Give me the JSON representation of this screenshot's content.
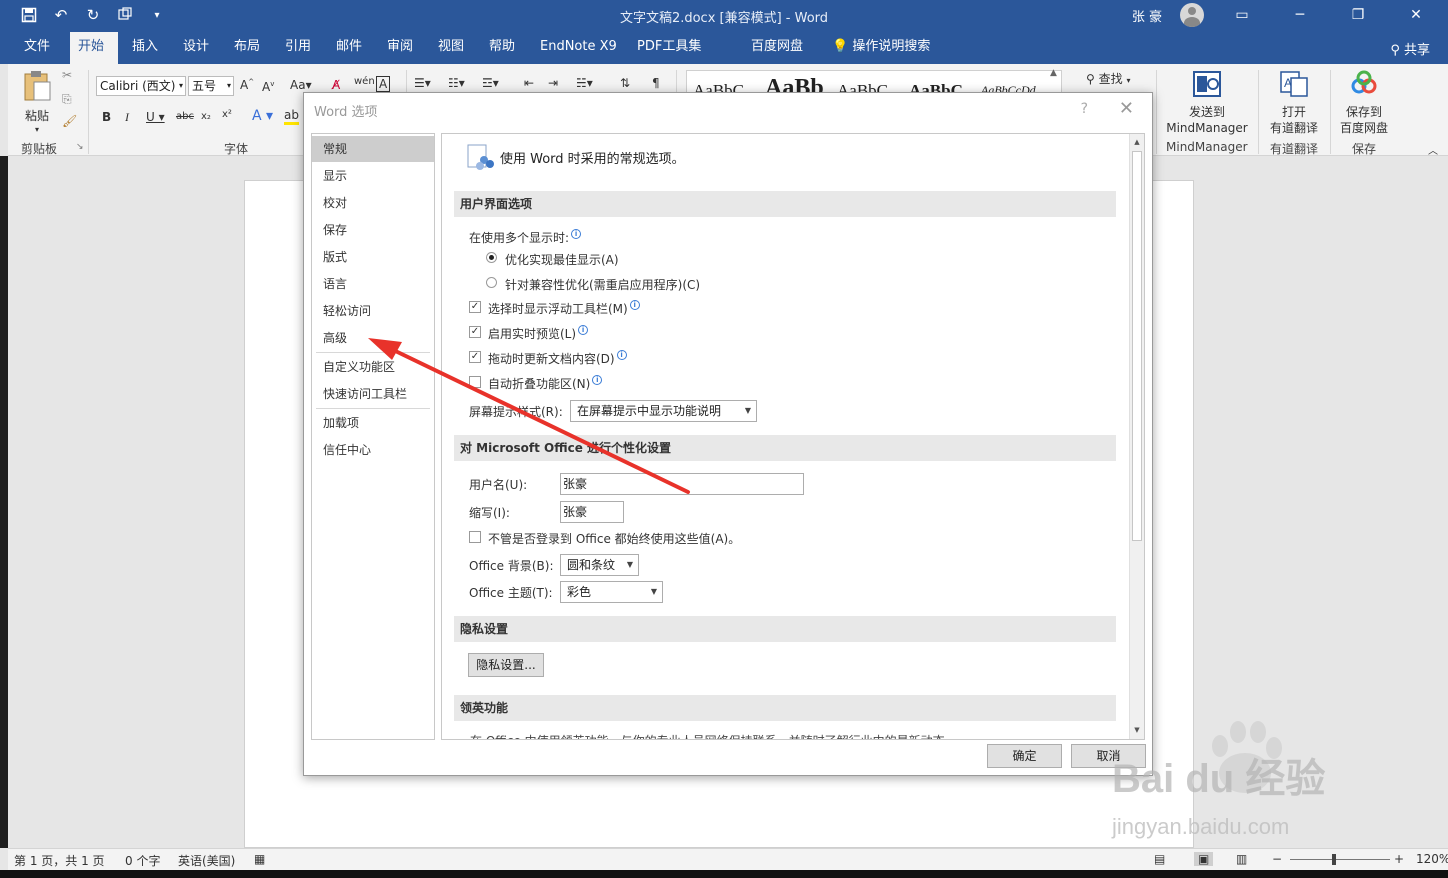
{
  "titlebar": {
    "doc_title": "文字文稿2.docx [兼容模式] - Word",
    "user_name": "张 豪",
    "qat_icons": [
      "save-icon",
      "undo-icon",
      "redo-icon",
      "touch-mode-icon",
      "customize-qat-icon"
    ]
  },
  "tabs": [
    {
      "label": "文件"
    },
    {
      "label": "开始"
    },
    {
      "label": "插入"
    },
    {
      "label": "设计"
    },
    {
      "label": "布局"
    },
    {
      "label": "引用"
    },
    {
      "label": "邮件"
    },
    {
      "label": "审阅"
    },
    {
      "label": "视图"
    },
    {
      "label": "帮助"
    },
    {
      "label": "EndNote X9"
    },
    {
      "label": "PDF工具集"
    },
    {
      "label": "百度网盘"
    },
    {
      "label": "操作说明搜索"
    }
  ],
  "share_label": "共享",
  "ribbon": {
    "paste_label": "粘贴",
    "clipboard_label": "剪贴板",
    "font_name": "Calibri (西文)",
    "font_size": "五号",
    "font_group_label": "字体",
    "styles_preview": [
      "AaBbC",
      "AaBb",
      "AaBbC",
      "AaBbC",
      "AaBbCcDd"
    ],
    "find_label": "查找",
    "mindmanager_send": "发送到",
    "mindmanager_name": "MindManager",
    "mindmanager_group": "MindManager",
    "youdao_open": "打开",
    "youdao_translate": "有道翻译",
    "youdao_group": "有道翻译",
    "baidu_save": "保存到",
    "baidu_disk": "百度网盘",
    "baidu_group": "保存"
  },
  "dialog": {
    "title": "Word 选项",
    "help": "?",
    "close": "✕",
    "nav_items": [
      {
        "label": "常规",
        "selected": true
      },
      {
        "label": "显示"
      },
      {
        "label": "校对"
      },
      {
        "label": "保存"
      },
      {
        "label": "版式"
      },
      {
        "label": "语言"
      },
      {
        "label": "轻松访问"
      },
      {
        "label": "高级"
      },
      {
        "label": "自定义功能区"
      },
      {
        "label": "快速访问工具栏"
      },
      {
        "label": "加载项"
      },
      {
        "label": "信任中心"
      }
    ],
    "intro": "使用 Word 时采用的常规选项。",
    "ui_section": "用户界面选项",
    "multi_display_label": "在使用多个显示时:",
    "radio_best": "优化实现最佳显示(A)",
    "radio_compat": "针对兼容性优化(需重启应用程序)(C)",
    "chk_minitoolbar": "选择时显示浮动工具栏(M)",
    "chk_livepreview": "启用实时预览(L)",
    "chk_dragupdate": "拖动时更新文档内容(D)",
    "chk_collapse": "自动折叠功能区(N)",
    "screentip_label": "屏幕提示样式(R):",
    "screentip_value": "在屏幕提示中显示功能说明",
    "personalize_section": "对 Microsoft Office 进行个性化设置",
    "username_label": "用户名(U):",
    "username_value": "张豪",
    "initials_label": "缩写(I):",
    "initials_value": "张豪",
    "always_use_label": "不管是否登录到 Office 都始终使用这些值(A)。",
    "bg_label": "Office 背景(B):",
    "bg_value": "圆和条纹",
    "theme_label": "Office 主题(T):",
    "theme_value": "彩色",
    "privacy_section": "隐私设置",
    "privacy_button": "隐私设置...",
    "linkedin_section": "领英功能",
    "linkedin_text": "在 Office 中使用领英功能，与你的专业人员网络保持联系，并随时了解行业中的最新动态。",
    "ok": "确定",
    "cancel": "取消"
  },
  "statusbar": {
    "page": "第 1 页，共 1 页",
    "words": "0 个字",
    "language": "英语(美国)",
    "zoom": "120%"
  },
  "watermark": {
    "brand": "Bai du 经验",
    "url": "jingyan.baidu.com"
  },
  "colors": {
    "title_blue": "#2b579a",
    "annotation_red": "#e8322a"
  }
}
